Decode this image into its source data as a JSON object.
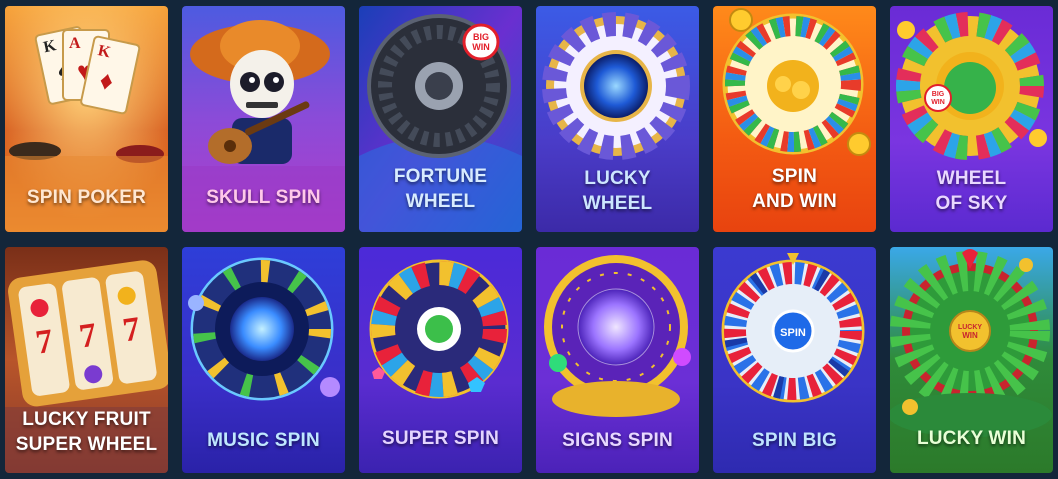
{
  "games": [
    {
      "title": "SPIN POKER",
      "label_color": "#ffe7d2",
      "icon": "poker-cards-icon"
    },
    {
      "title": "SKULL SPIN",
      "label_color": "#ffc8ea",
      "icon": "skull-guitar-icon"
    },
    {
      "title": "FORTUNE\nWHEEL",
      "label_color": "#d8ecff",
      "icon": "fortune-wheel-icon",
      "badge": "BIG\nWIN"
    },
    {
      "title": "LUCKY\nWHEEL",
      "label_color": "#cde6ff",
      "icon": "lucky-wheel-icon"
    },
    {
      "title": "SPIN\nAND WIN",
      "label_color": "#ffffff",
      "icon": "spin-and-win-wheel-icon"
    },
    {
      "title": "WHEEL\nOF SKY",
      "label_color": "#e9d8ff",
      "icon": "sky-wheel-icon",
      "badge": "BIG\nWIN"
    },
    {
      "title": "LUCKY FRUIT\nSUPER WHEEL",
      "label_color": "#ffffff",
      "icon": "slot-reels-icon"
    },
    {
      "title": "MUSIC SPIN",
      "label_color": "#bfe7ff",
      "icon": "music-wheel-icon"
    },
    {
      "title": "SUPER SPIN",
      "label_color": "#e4d4ff",
      "icon": "super-spin-wheel-icon"
    },
    {
      "title": "SIGNS SPIN",
      "label_color": "#e7d8ff",
      "icon": "zodiac-wheel-icon"
    },
    {
      "title": "SPIN BIG",
      "label_color": "#bfe4ff",
      "icon": "spin-big-wheel-icon",
      "badge": "SPIN"
    },
    {
      "title": "LUCKY WIN",
      "label_color": "#e8ffd6",
      "icon": "lucky-win-wheel-icon",
      "badge": "LUCKY\nWIN"
    }
  ]
}
